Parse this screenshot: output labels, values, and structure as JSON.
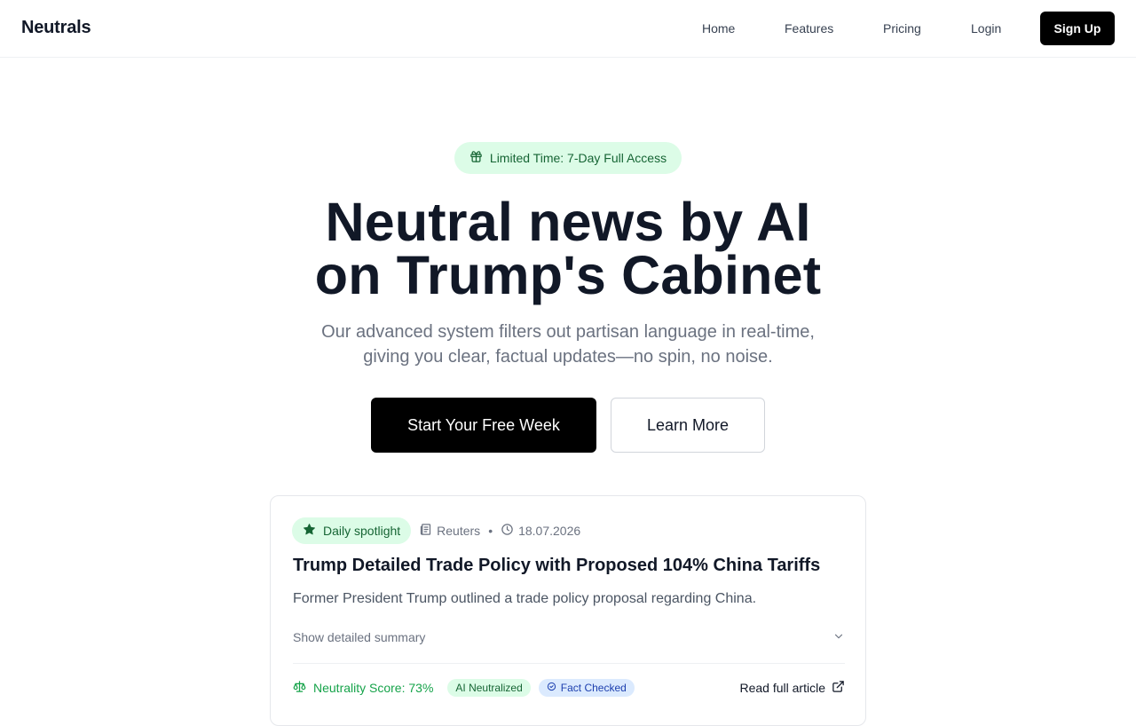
{
  "nav": {
    "brand": "Neutrals",
    "links": [
      "Home",
      "Features",
      "Pricing",
      "Login"
    ],
    "signup": "Sign Up"
  },
  "hero": {
    "promo": "Limited Time: 7-Day Full Access",
    "headline_line1": "Neutral news by AI",
    "headline_line2": "on Trump's Cabinet",
    "subhead_line1": "Our advanced system filters out partisan language in real-time,",
    "subhead_line2": "giving you clear, factual updates—no spin, no noise.",
    "primary_cta": "Start Your Free Week",
    "secondary_cta": "Learn More"
  },
  "card": {
    "badge": "Daily spotlight",
    "source": "Reuters",
    "separator": "•",
    "date": "18.07.2026",
    "title": "Trump Detailed Trade Policy with Proposed 104% China Tariffs",
    "description": "Former President Trump outlined a trade policy proposal regarding China.",
    "summary_toggle": "Show detailed summary",
    "neutrality_score": "Neutrality Score: 73%",
    "tag_neutralized": "AI Neutralized",
    "tag_fact_checked": "Fact Checked",
    "read_more": "Read full article"
  },
  "colors": {
    "accent_green": "#16a34a",
    "badge_green_bg": "#dcfce7",
    "badge_green_text": "#166534",
    "badge_blue_bg": "#dbeafe",
    "badge_blue_text": "#1e40af",
    "primary": "#000000"
  },
  "icons": [
    "gift-icon",
    "star-icon",
    "newspaper-icon",
    "clock-icon",
    "chevron-down-icon",
    "scale-icon",
    "check-circle-icon",
    "external-link-icon"
  ]
}
